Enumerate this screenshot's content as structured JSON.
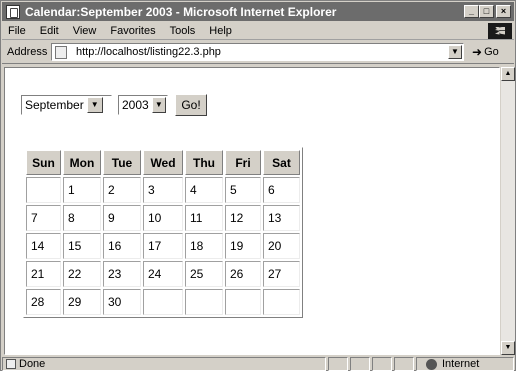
{
  "window": {
    "title": "Calendar:September 2003 - Microsoft Internet Explorer",
    "controls": {
      "minimize": "_",
      "restore": "□",
      "close": "×"
    }
  },
  "menu": [
    "File",
    "Edit",
    "View",
    "Favorites",
    "Tools",
    "Help"
  ],
  "address": {
    "label": "Address",
    "url": "http://localhost/listing22.3.php",
    "go_label": "Go"
  },
  "form": {
    "month": "September",
    "year": "2003",
    "button": "Go!"
  },
  "calendar": {
    "headers": [
      "Sun",
      "Mon",
      "Tue",
      "Wed",
      "Thu",
      "Fri",
      "Sat"
    ],
    "rows": [
      [
        "",
        "1",
        "2",
        "3",
        "4",
        "5",
        "6"
      ],
      [
        "7",
        "8",
        "9",
        "10",
        "11",
        "12",
        "13"
      ],
      [
        "14",
        "15",
        "16",
        "17",
        "18",
        "19",
        "20"
      ],
      [
        "21",
        "22",
        "23",
        "24",
        "25",
        "26",
        "27"
      ],
      [
        "28",
        "29",
        "30",
        "",
        "",
        "",
        ""
      ]
    ]
  },
  "status": {
    "text": "Done",
    "zone": "Internet"
  },
  "colors": {
    "title_bar": "#6c6c6c",
    "chrome": "#d4d0c8"
  }
}
